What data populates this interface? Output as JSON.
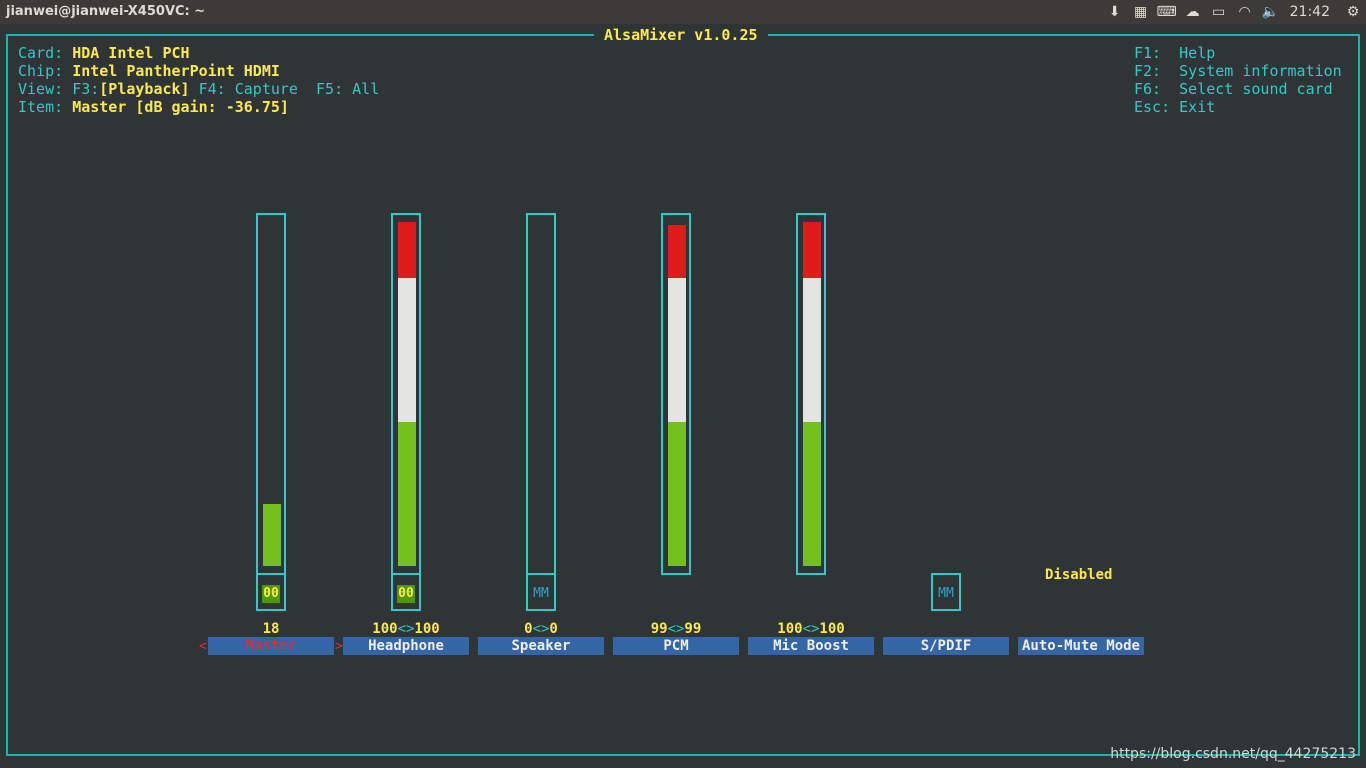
{
  "window": {
    "title": "jianwei@jianwei-X450VC: ~"
  },
  "tray": {
    "clock": "21:42"
  },
  "mixer": {
    "title": "AlsaMixer v1.0.25",
    "card_label": "Card:",
    "card_value": "HDA Intel PCH",
    "chip_label": "Chip:",
    "chip_value": "Intel PantherPoint HDMI",
    "view_label": "View:",
    "view_f3": "F3:",
    "view_playback": "[Playback]",
    "view_rest": " F4: Capture  F5: All",
    "item_label": "Item:",
    "item_value": "Master [dB gain: -36.75]",
    "help": [
      "F1:  Help",
      "F2:  System information",
      "F6:  Select sound card",
      "Esc: Exit"
    ],
    "channels": [
      {
        "name": "Master",
        "volume": "18",
        "level": 0.18,
        "mute": "00",
        "selected": true
      },
      {
        "name": "Headphone",
        "vol_left": "100",
        "vol_right": "100",
        "level": 1.0,
        "mute": "00"
      },
      {
        "name": "Speaker",
        "vol_left": "0",
        "vol_right": "0",
        "level": 0,
        "mute": "MM"
      },
      {
        "name": "PCM",
        "vol_left": "99",
        "vol_right": "99",
        "level": 0.99
      },
      {
        "name": "Mic Boost",
        "vol_left": "100",
        "vol_right": "100",
        "level": 1.0
      },
      {
        "name": "S/PDIF",
        "mute": "MM"
      },
      {
        "name": "Auto-Mute Mode",
        "status": "Disabled"
      }
    ],
    "vol_sep": "<>",
    "arrow_left": "<",
    "arrow_right": ">"
  },
  "watermark": "https://blog.csdn.net/qq_44275213",
  "colors": {
    "red": "#e01b1b",
    "white": "#e4e4e2",
    "green": "#73c11d",
    "cyan": "#34c8c8",
    "yellow": "#fce94f"
  }
}
